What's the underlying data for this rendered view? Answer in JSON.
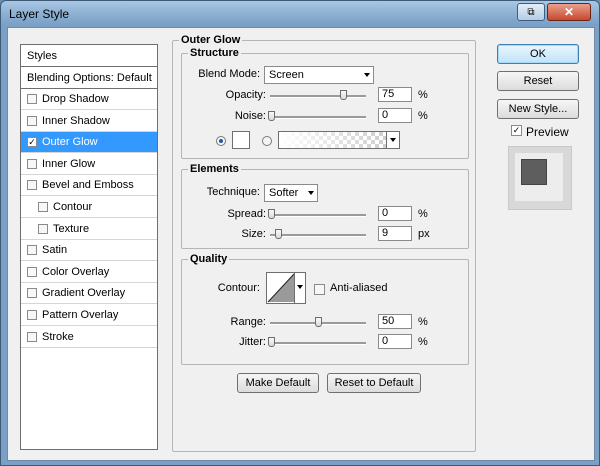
{
  "window": {
    "title": "Layer Style"
  },
  "styles_panel": {
    "header": "Styles",
    "blending": "Blending Options: Default",
    "items": [
      {
        "label": "Drop Shadow",
        "checked": false,
        "selected": false,
        "sub": false
      },
      {
        "label": "Inner Shadow",
        "checked": false,
        "selected": false,
        "sub": false
      },
      {
        "label": "Outer Glow",
        "checked": true,
        "selected": true,
        "sub": false
      },
      {
        "label": "Inner Glow",
        "checked": false,
        "selected": false,
        "sub": false
      },
      {
        "label": "Bevel and Emboss",
        "checked": false,
        "selected": false,
        "sub": false
      },
      {
        "label": "Contour",
        "checked": false,
        "selected": false,
        "sub": true
      },
      {
        "label": "Texture",
        "checked": false,
        "selected": false,
        "sub": true
      },
      {
        "label": "Satin",
        "checked": false,
        "selected": false,
        "sub": false
      },
      {
        "label": "Color Overlay",
        "checked": false,
        "selected": false,
        "sub": false
      },
      {
        "label": "Gradient Overlay",
        "checked": false,
        "selected": false,
        "sub": false
      },
      {
        "label": "Pattern Overlay",
        "checked": false,
        "selected": false,
        "sub": false
      },
      {
        "label": "Stroke",
        "checked": false,
        "selected": false,
        "sub": false
      }
    ]
  },
  "outer_glow": {
    "title": "Outer Glow",
    "structure": {
      "title": "Structure",
      "blend_mode_label": "Blend Mode:",
      "blend_mode_value": "Screen",
      "opacity_label": "Opacity:",
      "opacity_value": "75",
      "opacity_unit": "%",
      "noise_label": "Noise:",
      "noise_value": "0",
      "noise_unit": "%"
    },
    "elements": {
      "title": "Elements",
      "technique_label": "Technique:",
      "technique_value": "Softer",
      "spread_label": "Spread:",
      "spread_value": "0",
      "spread_unit": "%",
      "size_label": "Size:",
      "size_value": "9",
      "size_unit": "px"
    },
    "quality": {
      "title": "Quality",
      "contour_label": "Contour:",
      "anti_aliased_label": "Anti-aliased",
      "range_label": "Range:",
      "range_value": "50",
      "range_unit": "%",
      "jitter_label": "Jitter:",
      "jitter_value": "0",
      "jitter_unit": "%"
    },
    "make_default": "Make Default",
    "reset_to_default": "Reset to Default"
  },
  "buttons": {
    "ok": "OK",
    "reset": "Reset",
    "new_style": "New Style...",
    "preview": "Preview"
  },
  "colors": {
    "selection": "#3399ff",
    "glow_color": "#ffffff",
    "preview_fill": "#5e5e5e"
  }
}
